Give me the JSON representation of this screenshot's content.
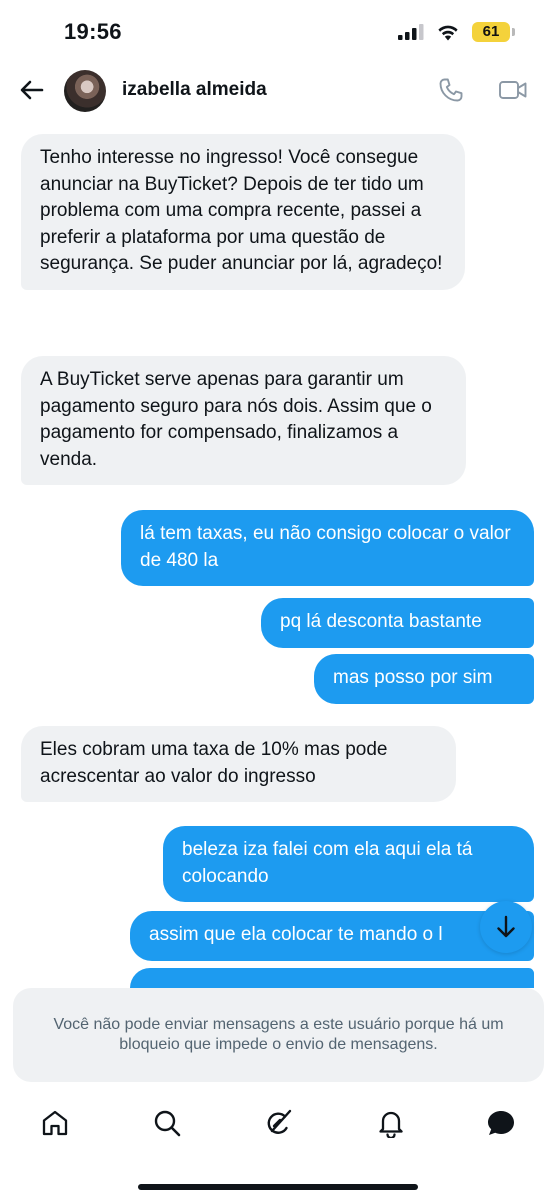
{
  "status_bar": {
    "time": "19:56",
    "battery": "61",
    "battery_color": "#f4d23b"
  },
  "header": {
    "contact_name": "izabella almeida",
    "icons": [
      "back-arrow-icon",
      "avatar",
      "phone-icon",
      "video-camera-icon"
    ]
  },
  "messages": [
    {
      "direction": "incoming",
      "text": "Tenho interesse no ingresso! Você consegue anunciar na BuyTicket? Depois de ter tido um problema com uma compra recente, passei a preferir a plataforma por uma questão de segurança. Se puder anunciar por lá, agradeço!"
    },
    {
      "direction": "incoming",
      "text": "A BuyTicket serve apenas para garantir um pagamento seguro para nós dois. Assim que o pagamento for compensado, finalizamos a venda."
    },
    {
      "direction": "outgoing",
      "text": "lá tem taxas, eu não consigo colocar o valor de 480 la"
    },
    {
      "direction": "outgoing",
      "text": "pq lá desconta bastante"
    },
    {
      "direction": "outgoing",
      "text": "mas posso por sim"
    },
    {
      "direction": "incoming",
      "text": "Eles cobram uma taxa de 10% mas pode acrescentar ao valor do ingresso"
    },
    {
      "direction": "outgoing",
      "text": "beleza iza falei com ela aqui ela tá colocando"
    },
    {
      "direction": "outgoing",
      "text": "assim que ela colocar te mando o l"
    },
    {
      "direction": "outgoing",
      "text": ""
    }
  ],
  "blocked_notice": "Você não pode enviar mensagens a este usuário porque há um bloqueio que impede o envio de mensagens.",
  "nav": [
    "home-icon",
    "search-icon",
    "grok-icon",
    "notifications-icon",
    "messages-icon"
  ],
  "colors": {
    "outgoing_bubble": "#1d9bf0",
    "incoming_bubble": "#eff1f3",
    "notice_text": "#536471"
  }
}
